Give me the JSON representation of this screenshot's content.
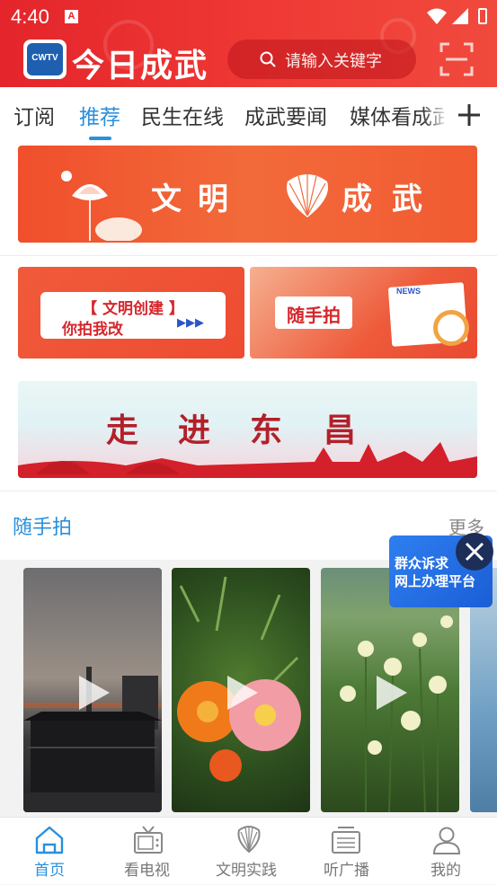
{
  "status_bar": {
    "time": "4:40",
    "notification_icon": "A"
  },
  "header": {
    "logo_text": "CWTV",
    "app_title": "今日成武",
    "search_placeholder": "请输入关键字",
    "scan_icon": "scan-icon"
  },
  "tabs": [
    {
      "label": "订阅",
      "active": false
    },
    {
      "label": "推荐",
      "active": true
    },
    {
      "label": "民生在线",
      "active": false
    },
    {
      "label": "成武要闻",
      "active": false
    },
    {
      "label": "媒体看成武",
      "active": false
    }
  ],
  "banners": {
    "civilization": [
      "文",
      "明",
      "成",
      "武"
    ],
    "report": {
      "line1": "【 文明创建 】",
      "line2": "你拍我改",
      "arrows": "▶▶▶"
    },
    "photo": {
      "label": "随手拍",
      "paper_label": "NEWS"
    },
    "dongchang": [
      "走",
      "进",
      "东",
      "昌"
    ]
  },
  "section": {
    "title": "随手拍",
    "more": "更多"
  },
  "gallery": [
    {
      "item": "sunset-pavilion",
      "type": "video"
    },
    {
      "item": "portulaca-flowers",
      "type": "video"
    },
    {
      "item": "white-flowers-field",
      "type": "video"
    }
  ],
  "float_ad": {
    "line1": "群众诉求",
    "line2": "网上办理平台"
  },
  "bottom_nav": [
    {
      "label": "首页",
      "icon": "home-icon",
      "active": true
    },
    {
      "label": "看电视",
      "icon": "tv-icon",
      "active": false
    },
    {
      "label": "文明实践",
      "icon": "fan-icon",
      "active": false
    },
    {
      "label": "听广播",
      "icon": "radio-icon",
      "active": false
    },
    {
      "label": "我的",
      "icon": "user-icon",
      "active": false
    }
  ],
  "colors": {
    "brand_red": "#e4252b",
    "accent_blue": "#2a8fdc",
    "nav_inactive": "#777777"
  }
}
